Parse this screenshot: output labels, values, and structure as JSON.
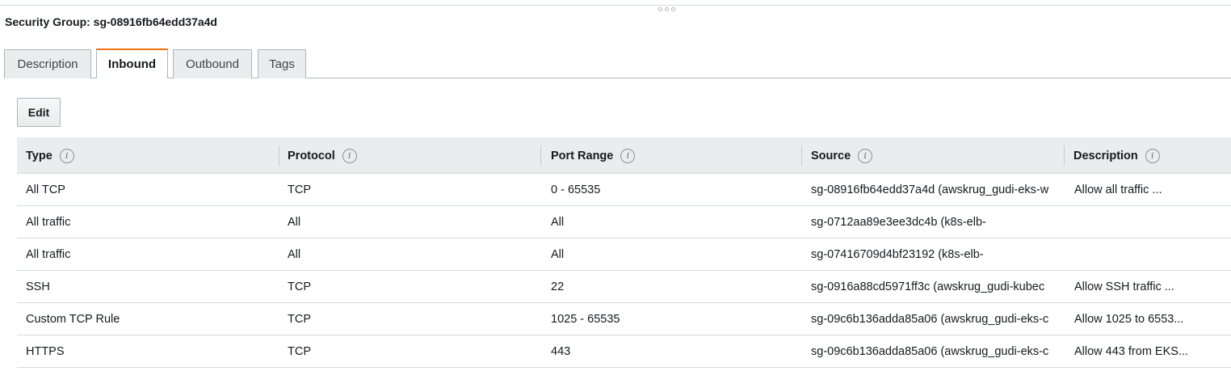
{
  "title": "Security Group: sg-08916fb64edd37a4d",
  "tabs": [
    {
      "label": "Description",
      "active": false
    },
    {
      "label": "Inbound",
      "active": true
    },
    {
      "label": "Outbound",
      "active": false
    },
    {
      "label": "Tags",
      "active": false
    }
  ],
  "actions": {
    "edit_label": "Edit"
  },
  "table": {
    "columns": [
      "Type",
      "Protocol",
      "Port Range",
      "Source",
      "Description"
    ],
    "rows": [
      [
        "All TCP",
        "TCP",
        "0 - 65535",
        "sg-08916fb64edd37a4d (awskrug_gudi-eks-w",
        "Allow all traffic ..."
      ],
      [
        "All traffic",
        "All",
        "All",
        "sg-0712aa89e3ee3dc4b (k8s-elb-",
        ""
      ],
      [
        "All traffic",
        "All",
        "All",
        "sg-07416709d4bf23192 (k8s-elb-",
        ""
      ],
      [
        "SSH",
        "TCP",
        "22",
        "sg-0916a88cd5971ff3c (awskrug_gudi-kubec",
        "Allow SSH traffic ..."
      ],
      [
        "Custom TCP Rule",
        "TCP",
        "1025 - 65535",
        "sg-09c6b136adda85a06 (awskrug_gudi-eks-c",
        "Allow 1025 to 6553..."
      ],
      [
        "HTTPS",
        "TCP",
        "443",
        "sg-09c6b136adda85a06 (awskrug_gudi-eks-c",
        "Allow 443 from EKS..."
      ]
    ]
  },
  "icons": {
    "info": "info-icon",
    "resize": "resize-handle-icon"
  },
  "colors": {
    "accent": "#ec7211",
    "header_bg": "#eaeded",
    "border": "#d5dbdb"
  }
}
